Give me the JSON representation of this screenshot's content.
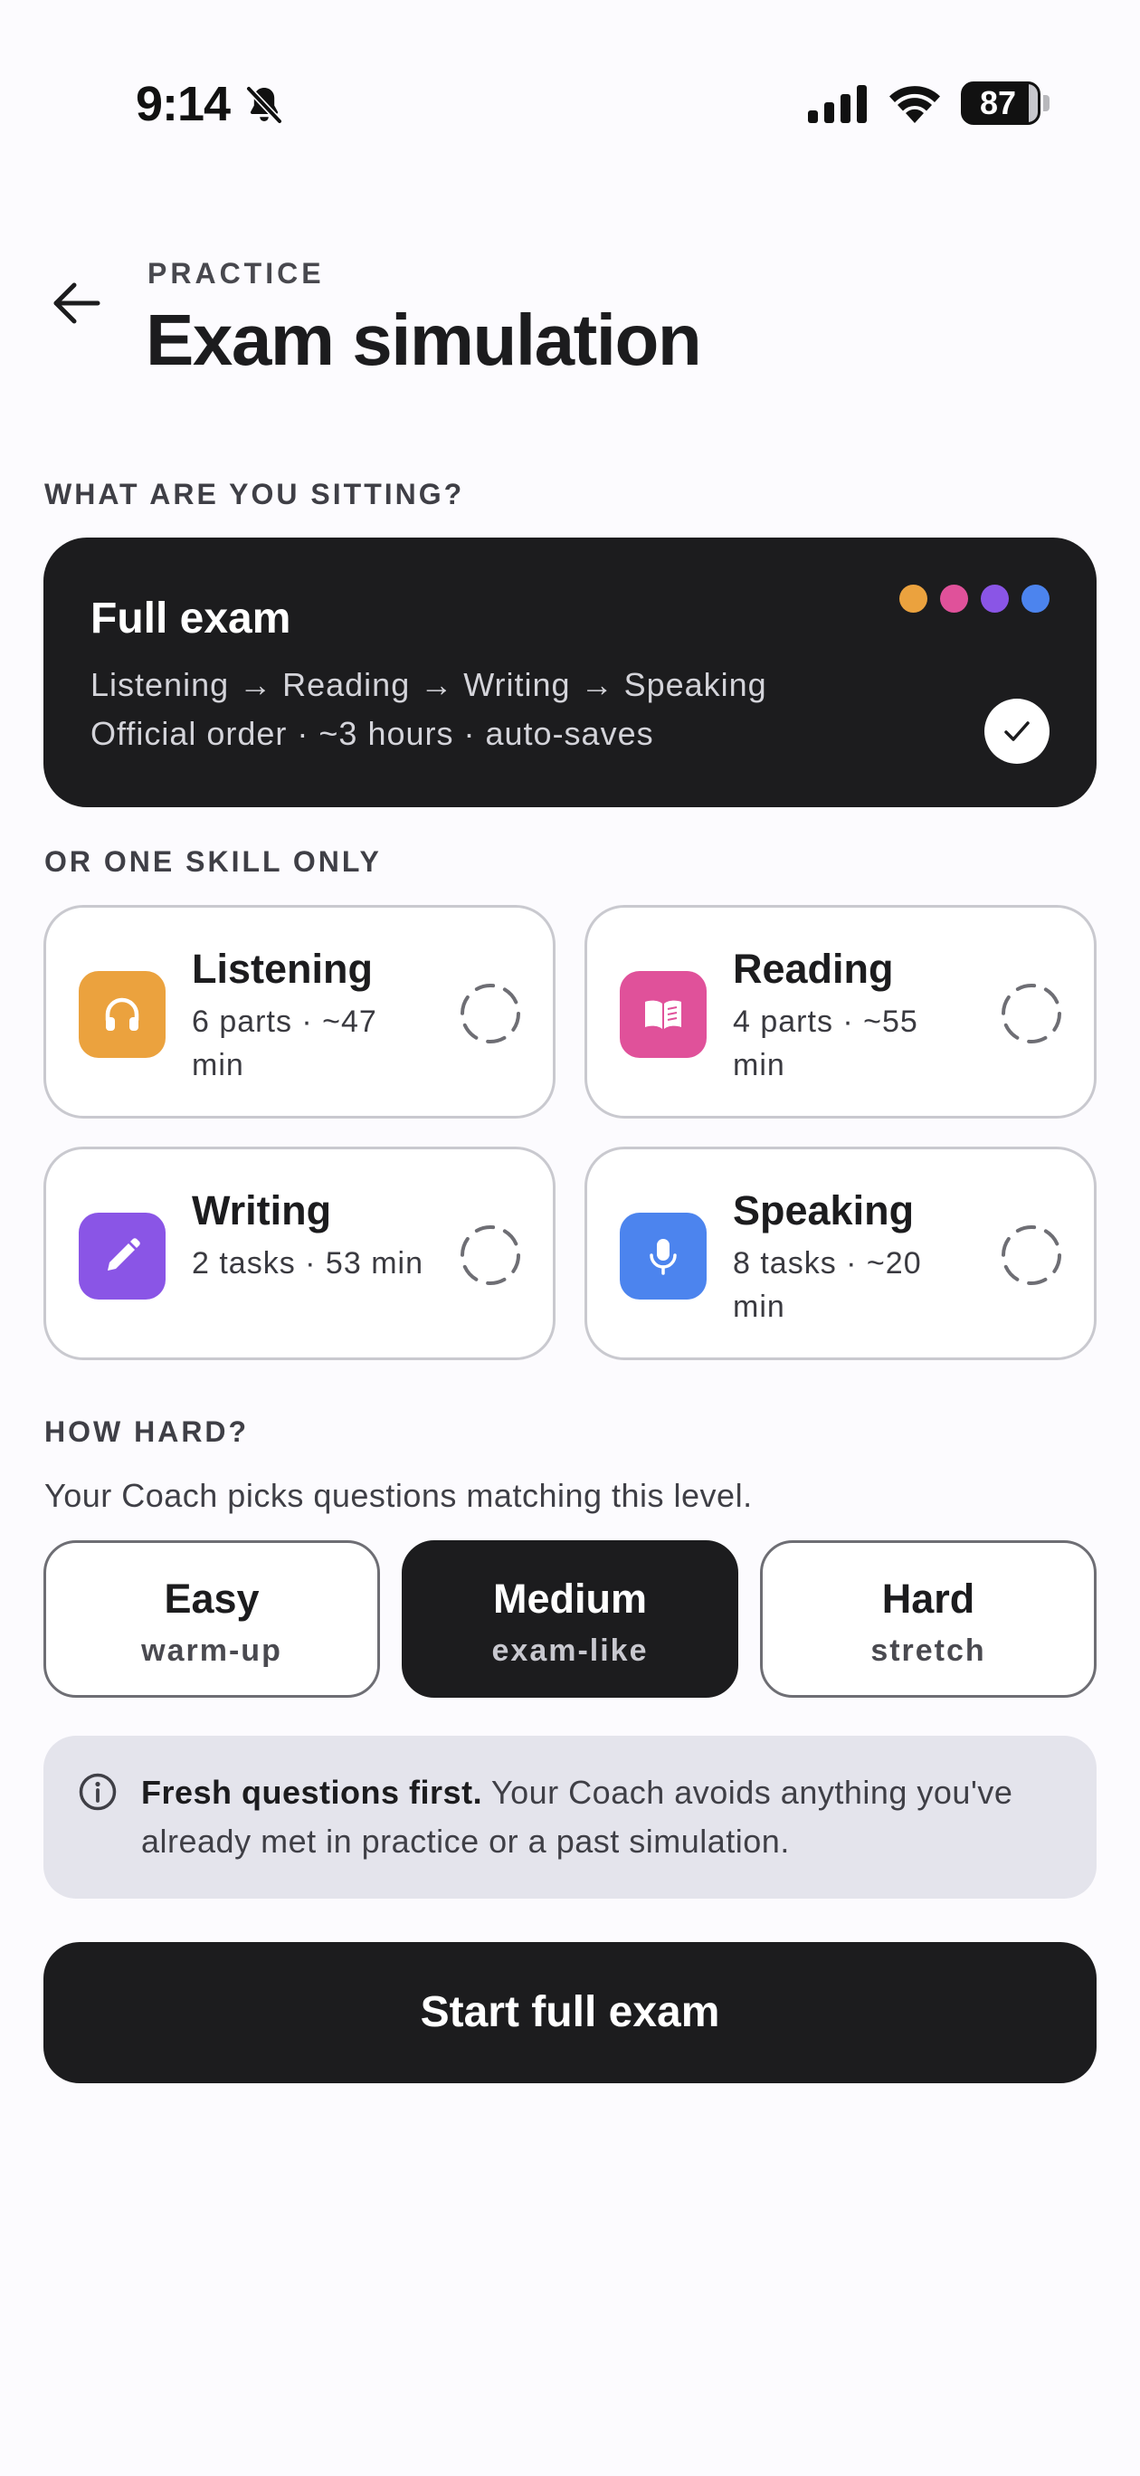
{
  "status_bar": {
    "time": "9:14",
    "battery": "87"
  },
  "header": {
    "eyebrow": "PRACTICE",
    "title": "Exam simulation"
  },
  "sitting_section": {
    "label": "WHAT ARE YOU SITTING?"
  },
  "full_exam": {
    "title": "Full exam",
    "sequence": "Listening → Reading → Writing → Speaking",
    "details": "Official order · ~3 hours · auto-saves",
    "selected": true,
    "dot_colors": [
      "#eba23e",
      "#e0519a",
      "#8a55e6",
      "#4c84ee"
    ]
  },
  "skill_section": {
    "label": "OR ONE SKILL ONLY"
  },
  "skills": [
    {
      "name": "Listening",
      "meta": "6 parts · ~47 min",
      "color": "#eba23e",
      "icon": "headphones-icon"
    },
    {
      "name": "Reading",
      "meta": "4 parts · ~55 min",
      "color": "#e0519a",
      "icon": "book-icon"
    },
    {
      "name": "Writing",
      "meta": "2 tasks · 53 min",
      "color": "#8a55e6",
      "icon": "pencil-icon"
    },
    {
      "name": "Speaking",
      "meta": "8 tasks · ~20 min",
      "color": "#4c84ee",
      "icon": "microphone-icon"
    }
  ],
  "difficulty": {
    "label": "HOW HARD?",
    "hint": "Your Coach picks questions matching this level.",
    "options": [
      {
        "label": "Easy",
        "sub": "warm-up"
      },
      {
        "label": "Medium",
        "sub": "exam-like"
      },
      {
        "label": "Hard",
        "sub": "stretch"
      }
    ],
    "selected": "Medium"
  },
  "info": {
    "bold": "Fresh questions first.",
    "text": " Your Coach avoids anything you've already met in practice or a past simulation."
  },
  "start_button": {
    "label": "Start full exam"
  }
}
